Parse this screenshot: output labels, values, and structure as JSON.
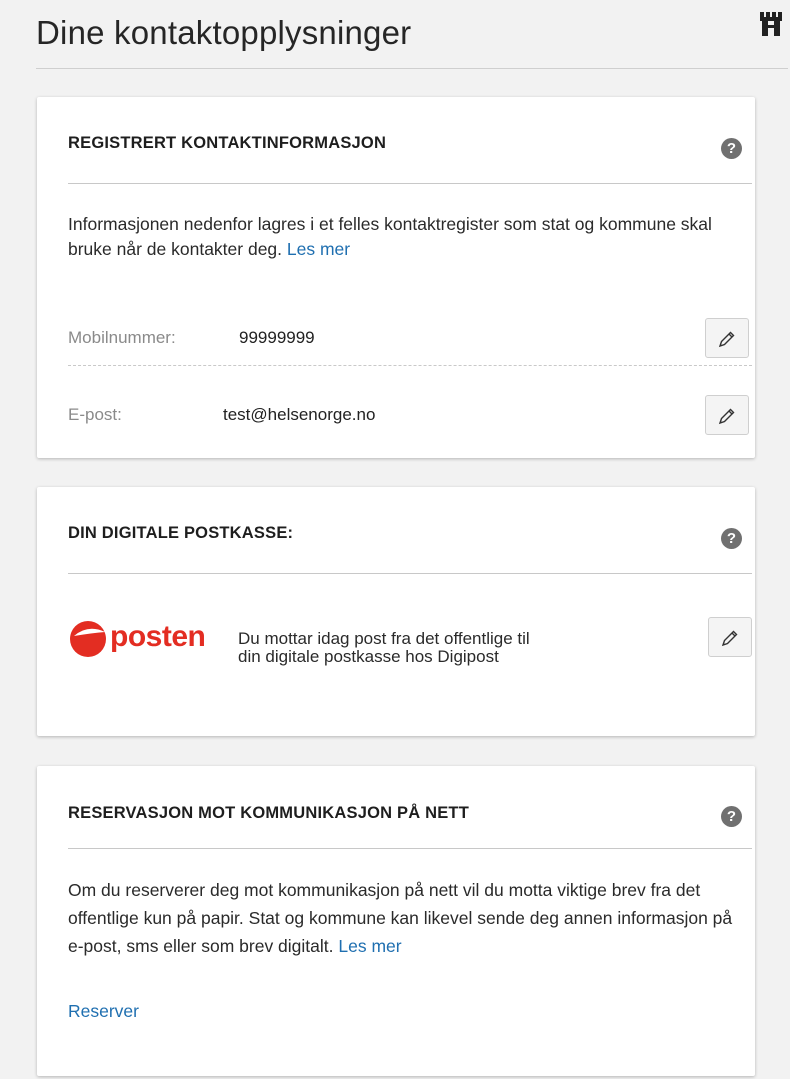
{
  "page": {
    "title": "Dine kontaktopplysninger"
  },
  "registered": {
    "title": "REGISTRERT KONTAKTINFORMASJON",
    "help": "?",
    "intro": "Informasjonen nedenfor lagres i et felles kontaktregister som stat og kommune skal bruke når de kontakter deg. ",
    "read_more": "Les mer",
    "fields": [
      {
        "label": "Mobilnummer:",
        "value": "99999999"
      },
      {
        "label": "E-post:",
        "value": "test@helsenorge.no"
      }
    ]
  },
  "postbox": {
    "title": "DIN DIGITALE POSTKASSE:",
    "help": "?",
    "logo_text": "posten",
    "line1": "Du mottar idag post fra det offentlige til",
    "line2": "din digitale postkasse hos Digipost"
  },
  "reservation": {
    "title": "RESERVASJON MOT KOMMUNIKASJON PÅ NETT",
    "help": "?",
    "intro": "Om du reserverer deg mot kommunikasjon på nett vil du motta viktige brev fra det offentlige kun på papir. Stat og kommune kan likevel sende deg annen informasjon på e-post, sms eller som brev digitalt. ",
    "read_more": "Les mer",
    "reserve_label": "Reserver"
  },
  "colors": {
    "link": "#1f6fb0",
    "posten_red": "#e32d22",
    "help_icon": "#707070"
  },
  "icons": {
    "edit": "pencil-icon",
    "help": "question-circle-icon",
    "header": "castle-icon"
  }
}
